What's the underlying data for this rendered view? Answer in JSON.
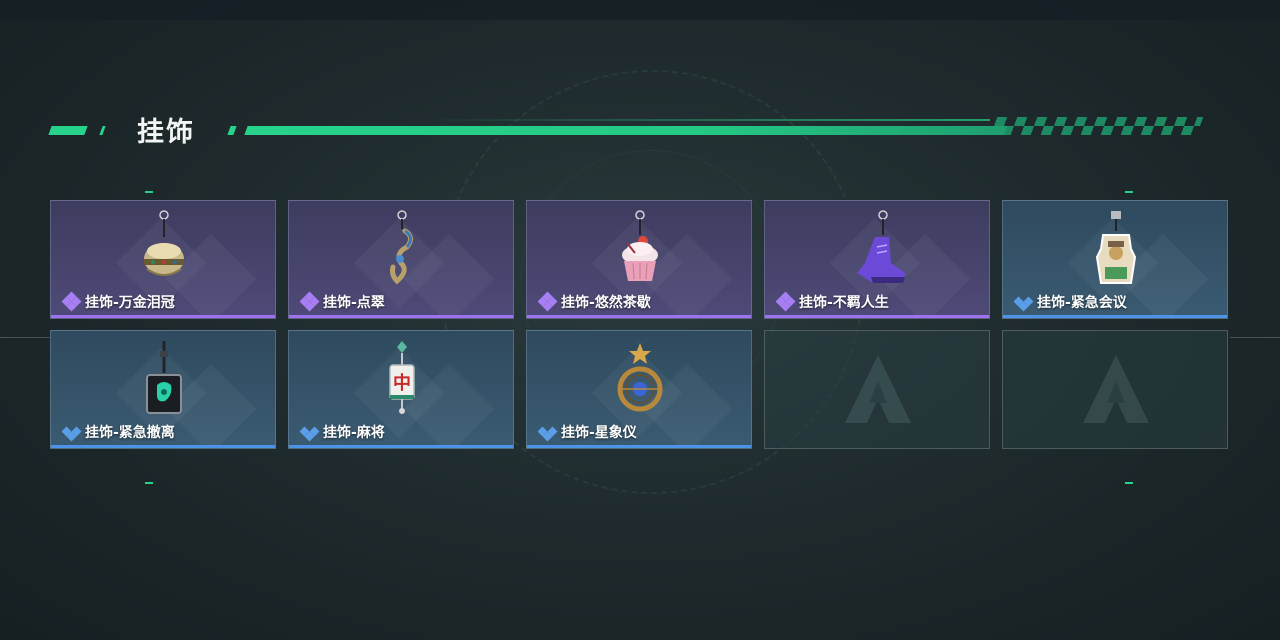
{
  "section": {
    "title": "挂饰"
  },
  "items": [
    {
      "label": "挂饰-万金泪冠",
      "rarity": "purple",
      "icon": "crown-charm-icon"
    },
    {
      "label": "挂饰-点翠",
      "rarity": "purple",
      "icon": "phoenix-charm-icon"
    },
    {
      "label": "挂饰-悠然茶歇",
      "rarity": "purple",
      "icon": "cupcake-charm-icon"
    },
    {
      "label": "挂饰-不羁人生",
      "rarity": "purple",
      "icon": "sneaker-charm-icon"
    },
    {
      "label": "挂饰-紧急会议",
      "rarity": "blue",
      "icon": "acrylic-badge-charm-icon"
    },
    {
      "label": "挂饰-紧急撤离",
      "rarity": "blue",
      "icon": "square-pendant-charm-icon"
    },
    {
      "label": "挂饰-麻将",
      "rarity": "blue",
      "icon": "mahjong-tile-charm-icon"
    },
    {
      "label": "挂饰-星象仪",
      "rarity": "blue",
      "icon": "astrolabe-charm-icon"
    },
    {
      "label": "",
      "rarity": "empty",
      "icon": "game-logo-icon"
    },
    {
      "label": "",
      "rarity": "empty",
      "icon": "game-logo-icon"
    }
  ],
  "colors": {
    "accent": "#27d38a",
    "purple_rarity": "#9c72ee",
    "blue_rarity": "#4d94e8"
  }
}
